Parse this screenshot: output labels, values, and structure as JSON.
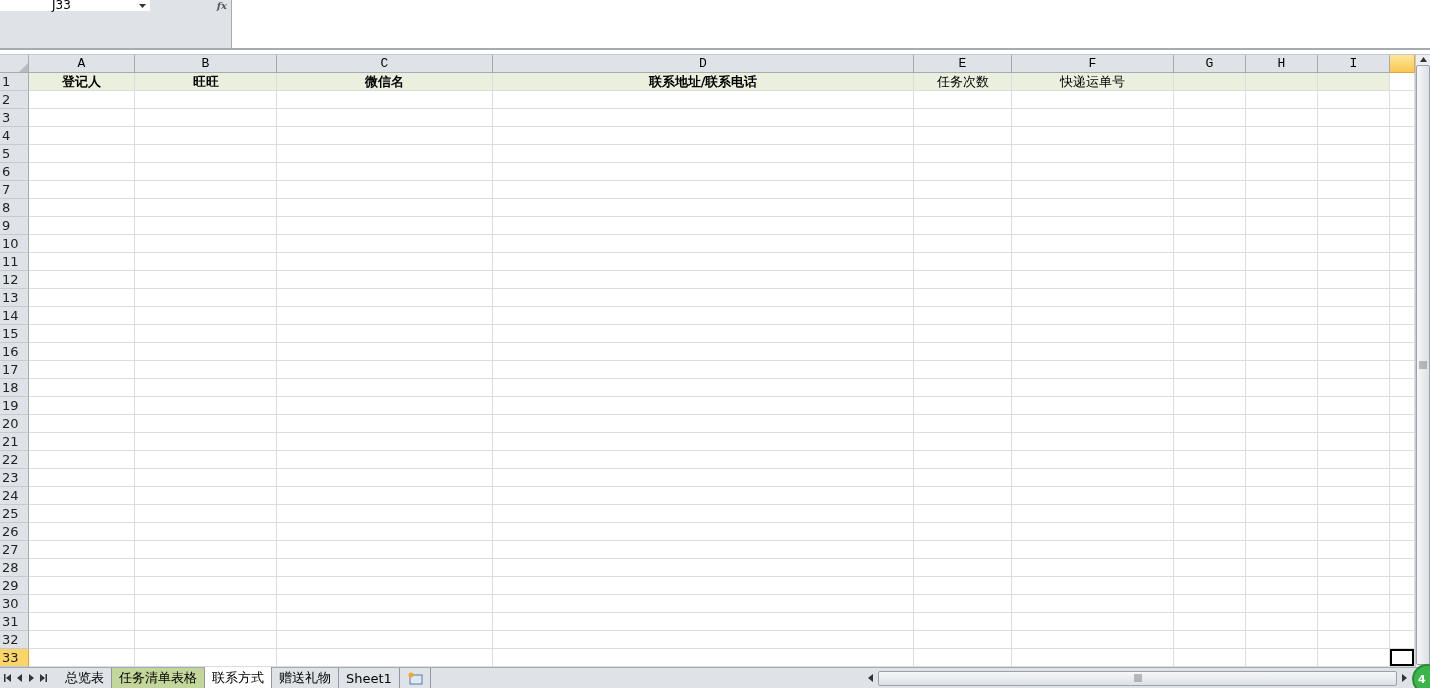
{
  "name_box": {
    "value": "J33"
  },
  "formula_bar": {
    "label": "fx"
  },
  "columns": [
    {
      "letter": "A",
      "selected": false
    },
    {
      "letter": "B",
      "selected": false
    },
    {
      "letter": "C",
      "selected": false
    },
    {
      "letter": "D",
      "selected": false
    },
    {
      "letter": "E",
      "selected": false
    },
    {
      "letter": "F",
      "selected": false
    },
    {
      "letter": "G",
      "selected": false
    },
    {
      "letter": "H",
      "selected": false
    },
    {
      "letter": "I",
      "selected": false
    },
    {
      "selected": true
    }
  ],
  "header_row": [
    {
      "text": "登记人",
      "bold": true
    },
    {
      "text": "旺旺",
      "bold": true
    },
    {
      "text": "微信名",
      "bold": true
    },
    {
      "text": "联系地址/联系电话",
      "bold": true
    },
    {
      "text": "任务次数",
      "bold": false
    },
    {
      "text": "快递运单号",
      "bold": false
    }
  ],
  "rows": [
    {
      "number": "1",
      "selected": false
    },
    {
      "number": "2",
      "selected": false
    },
    {
      "number": "3",
      "selected": false
    },
    {
      "number": "4",
      "selected": false
    },
    {
      "number": "5",
      "selected": false
    },
    {
      "number": "6",
      "selected": false
    },
    {
      "number": "7",
      "selected": false
    },
    {
      "number": "8",
      "selected": false
    },
    {
      "number": "9",
      "selected": false
    },
    {
      "number": "10",
      "selected": false
    },
    {
      "number": "11",
      "selected": false
    },
    {
      "number": "12",
      "selected": false
    },
    {
      "number": "13",
      "selected": false
    },
    {
      "number": "14",
      "selected": false
    },
    {
      "number": "15",
      "selected": false
    },
    {
      "number": "16",
      "selected": false
    },
    {
      "number": "17",
      "selected": false
    },
    {
      "number": "18",
      "selected": false
    },
    {
      "number": "19",
      "selected": false
    },
    {
      "number": "20",
      "selected": false
    },
    {
      "number": "21",
      "selected": false
    },
    {
      "number": "22",
      "selected": false
    },
    {
      "number": "23",
      "selected": false
    },
    {
      "number": "24",
      "selected": false
    },
    {
      "number": "25",
      "selected": false
    },
    {
      "number": "26",
      "selected": false
    },
    {
      "number": "27",
      "selected": false
    },
    {
      "number": "28",
      "selected": false
    },
    {
      "number": "29",
      "selected": false
    },
    {
      "number": "30",
      "selected": false
    },
    {
      "number": "31",
      "selected": false
    },
    {
      "number": "32",
      "selected": false
    },
    {
      "number": "33",
      "selected": true
    }
  ],
  "sheet_tabs": [
    {
      "label": "总览表",
      "selected": false
    },
    {
      "label": "任务清单表格",
      "selected": false,
      "color": "#c4d79b"
    },
    {
      "label": "联系方式",
      "selected": true
    },
    {
      "label": "赠送礼物",
      "selected": false
    },
    {
      "label": "Sheet1",
      "selected": false
    }
  ],
  "floating_badge": {
    "text": "4"
  }
}
